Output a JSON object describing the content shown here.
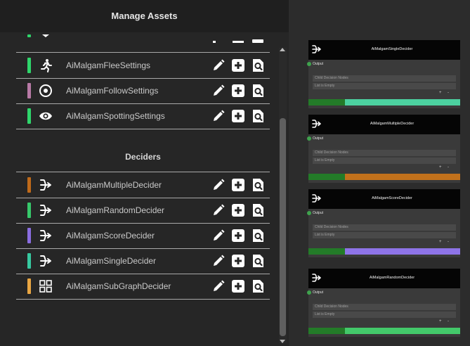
{
  "header": {
    "title": "Manage Assets"
  },
  "colors": {
    "edit": "#ffffff",
    "add": "#ffffff",
    "find": "#ffffff",
    "port": "#3fa34d",
    "node_stripe_left": "#237b28"
  },
  "rows_top": [
    {
      "label": "AiMalgamFleeSettings",
      "bar_color": "#2fd66b",
      "icon": "running-person-icon"
    },
    {
      "label": "AiMalgamFollowSettings",
      "bar_color": "#b87aa6",
      "icon": "target-circle-icon"
    },
    {
      "label": "AiMalgamSpottingSettings",
      "bar_color": "#2fd66b",
      "icon": "eye-icon"
    }
  ],
  "deciders_section": {
    "title": "Deciders"
  },
  "rows_deciders": [
    {
      "label": "AiMalgamMultipleDecider",
      "bar_color": "#bf6a1a",
      "icon": "decision-split-icon"
    },
    {
      "label": "AiMalgamRandomDecider",
      "bar_color": "#37c86a",
      "icon": "decision-split-icon"
    },
    {
      "label": "AiMalgamScoreDecider",
      "bar_color": "#8a6de0",
      "icon": "decision-split-icon"
    },
    {
      "label": "AiMalgamSingleDecider",
      "bar_color": "#37c9a0",
      "icon": "decision-split-icon"
    },
    {
      "label": "AiMalgamSubGraphDecider",
      "bar_color": "#e9a643",
      "icon": "grid-squares-icon"
    }
  ],
  "graph_nodes": [
    {
      "title": "AiMalgamSingleDecider",
      "port_label": "Output",
      "field1": "Child Decision Nodes",
      "field2": "List is Empty",
      "plus": "+",
      "minus": "-",
      "stripe_color": "#4cd1a0"
    },
    {
      "title": "AiMalgamMultipleDecider",
      "port_label": "Output",
      "field1": "Child Decision Nodes",
      "field2": "List is Empty",
      "plus": "+",
      "minus": "-",
      "stripe_color": "#c2711b"
    },
    {
      "title": "AiMalgamScoreDecider",
      "port_label": "Output",
      "field1": "Child Decision Nodes",
      "field2": "List is Empty",
      "plus": "+",
      "minus": "-",
      "stripe_color": "#8e74e8"
    },
    {
      "title": "AiMalgamRandomDecider",
      "port_label": "Output",
      "field1": "Child Decision Nodes",
      "field2": "List is Empty",
      "plus": "+",
      "minus": "-",
      "stripe_color": "#43c96a"
    }
  ]
}
